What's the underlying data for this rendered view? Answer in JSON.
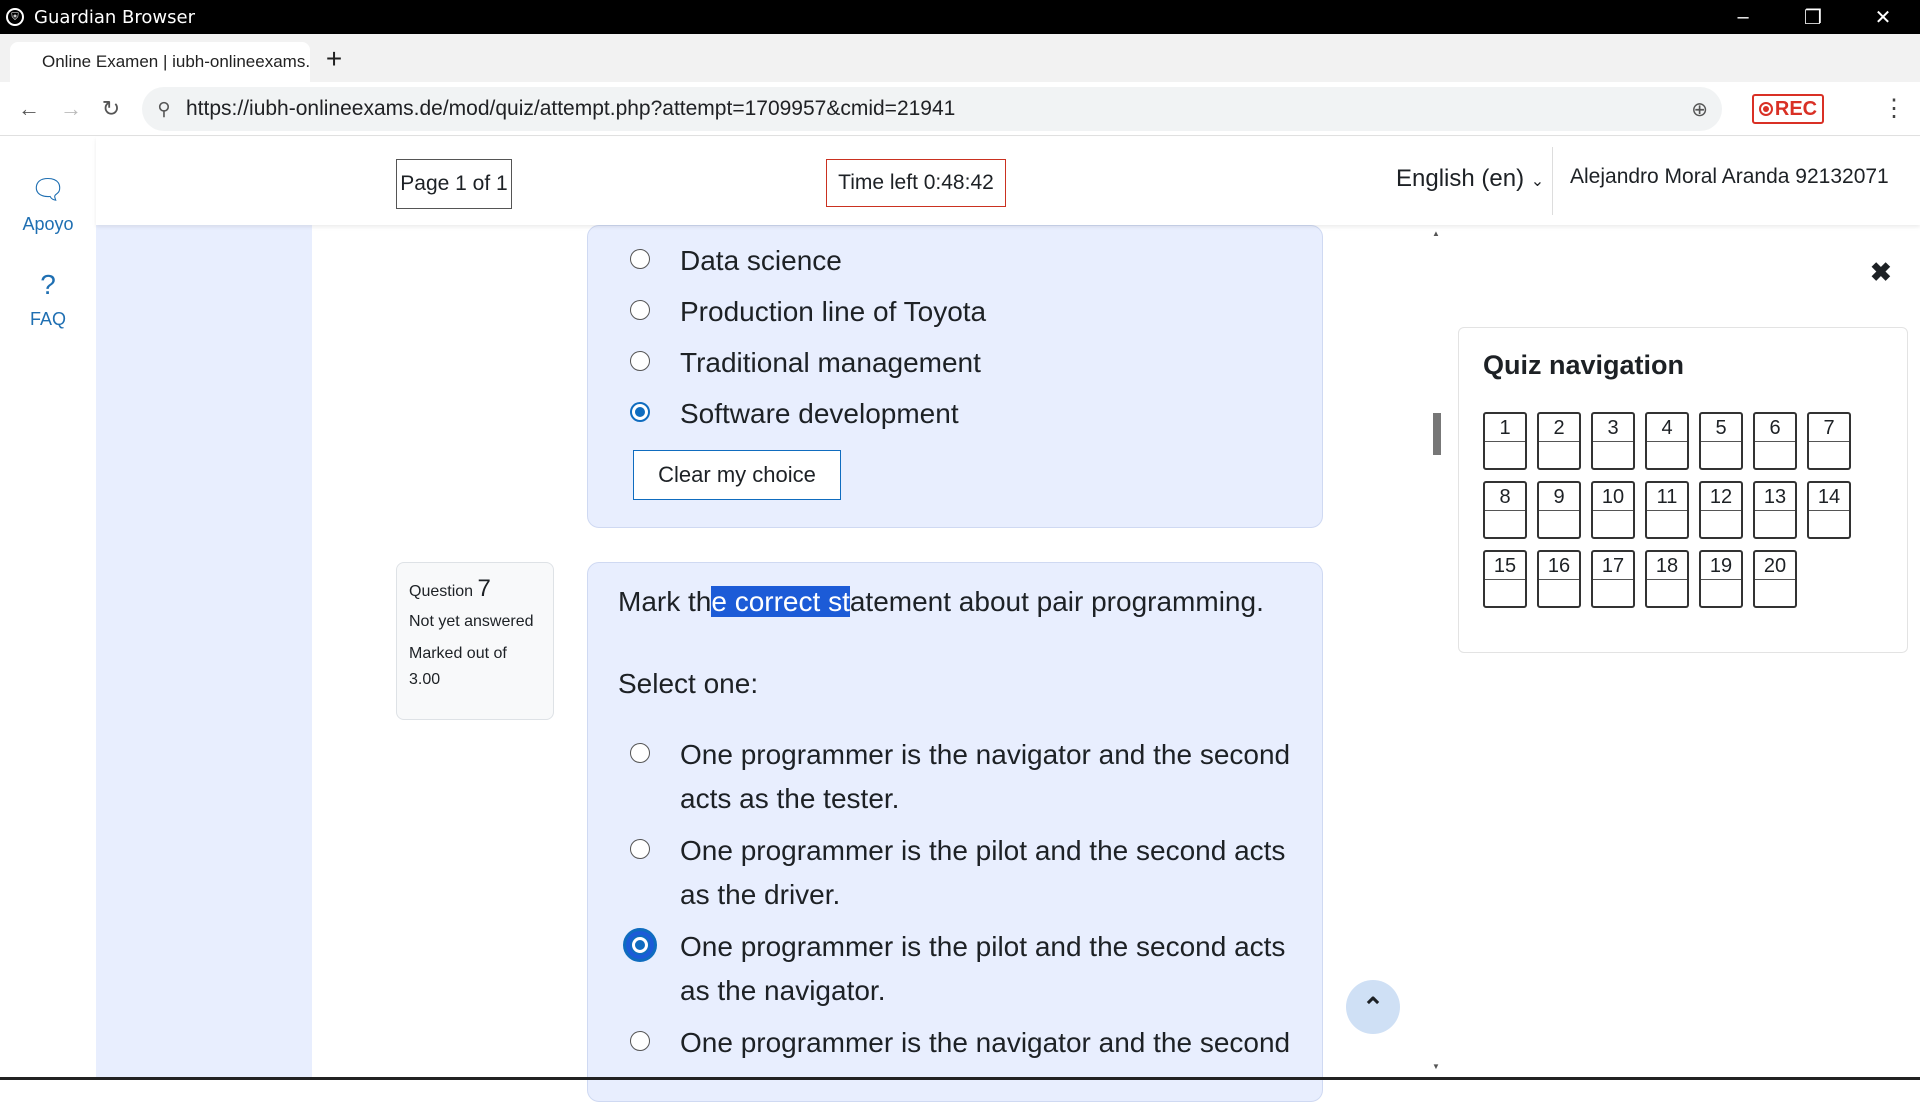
{
  "window": {
    "title": "Guardian Browser"
  },
  "tab": {
    "title": "Online Examen | iubh-onlineexams.d",
    "new_tab": "+"
  },
  "address_bar": {
    "url": "https://iubh-onlineexams.de/mod/quiz/attempt.php?attempt=1709957&cmid=21941",
    "rec_label": "REC"
  },
  "left_rail": {
    "items": [
      {
        "label": "Apoyo",
        "icon": "chat-bubbles-icon"
      },
      {
        "label": "FAQ",
        "icon": "question-icon"
      }
    ]
  },
  "header": {
    "page_indicator": "Page 1 of 1",
    "timer": "Time left 0:48:42",
    "language": "English (en)",
    "user": "Alejandro Moral Aranda 92132071"
  },
  "question6": {
    "options": [
      {
        "label": "Data science",
        "selected": false
      },
      {
        "label": "Production line of Toyota",
        "selected": false
      },
      {
        "label": "Traditional management",
        "selected": false
      },
      {
        "label": "Software development",
        "selected": true
      }
    ],
    "clear_label": "Clear my choice"
  },
  "question7": {
    "label": "Question",
    "number": "7",
    "status": "Not yet answered",
    "marked": "Marked out of 3.00",
    "text_before": "Mark th",
    "text_highlight": "e correct st",
    "text_after": "atement about pair programming.",
    "select_prompt": "Select one:",
    "options": [
      {
        "line1": "One programmer is the navigator and the second",
        "line2": "acts as the tester.",
        "selected": false
      },
      {
        "line1": "One programmer is the pilot and the second acts",
        "line2": "as the driver.",
        "selected": false
      },
      {
        "line1": "One programmer is the pilot and the second acts",
        "line2": "as the navigator.",
        "selected": true
      },
      {
        "line1": "One programmer is the navigator and the second",
        "line2": "",
        "selected": false
      }
    ]
  },
  "quiz_navigation": {
    "title": "Quiz navigation",
    "questions": [
      "1",
      "2",
      "3",
      "4",
      "5",
      "6",
      "7",
      "8",
      "9",
      "10",
      "11",
      "12",
      "13",
      "14",
      "15",
      "16",
      "17",
      "18",
      "19",
      "20"
    ]
  },
  "colors": {
    "accent": "#0f6cbf",
    "highlight": "#1c5bd7",
    "timer_border": "#ca3120",
    "content_bg": "#e8eefe"
  }
}
